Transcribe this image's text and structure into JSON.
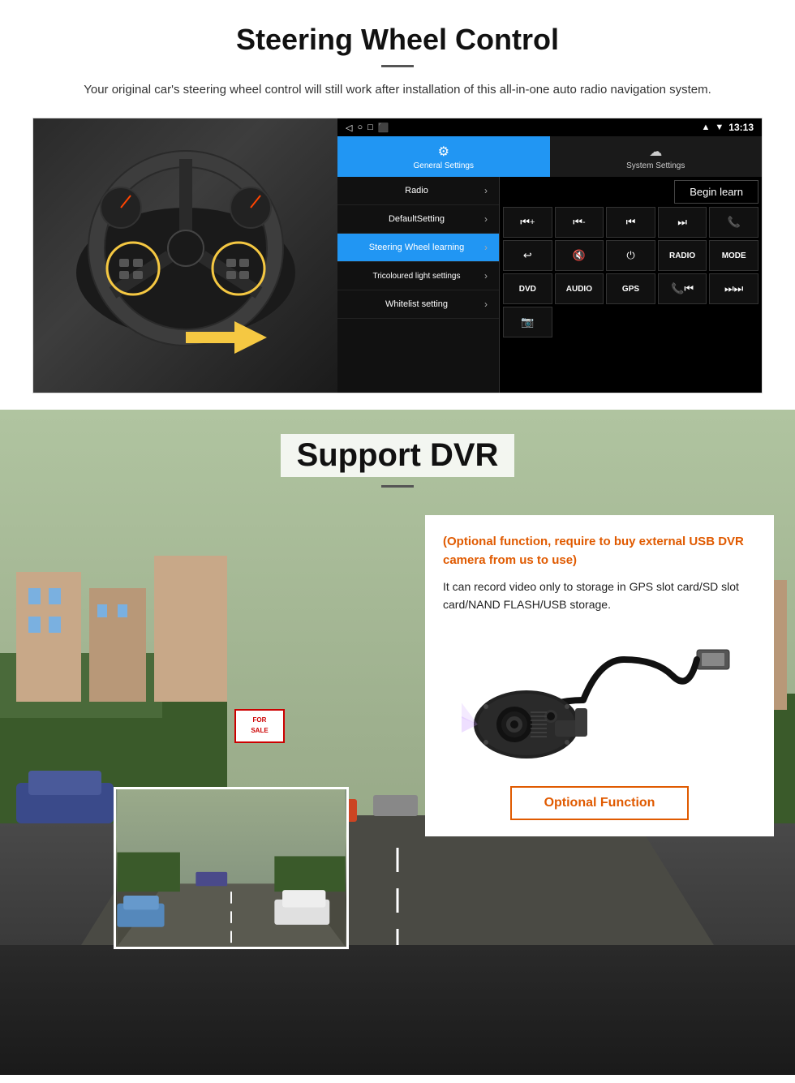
{
  "steering": {
    "title": "Steering Wheel Control",
    "subtitle": "Your original car's steering wheel control will still work after installation of this all-in-one auto radio navigation system.",
    "statusbar": {
      "time": "13:13",
      "icons": [
        "▲",
        "▼",
        "□",
        "⬛"
      ]
    },
    "tabs": {
      "general": "General Settings",
      "system": "System Settings"
    },
    "menu_items": [
      {
        "label": "Radio",
        "active": false
      },
      {
        "label": "DefaultSetting",
        "active": false
      },
      {
        "label": "Steering Wheel learning",
        "active": true
      },
      {
        "label": "Tricoloured light settings",
        "active": false
      },
      {
        "label": "Whitelist setting",
        "active": false
      }
    ],
    "begin_learn": "Begin learn",
    "control_buttons": [
      "⏮+",
      "⏮-",
      "⏮",
      "⏭",
      "📞",
      "↩",
      "🔇",
      "⏻",
      "RADIO",
      "MODE",
      "DVD",
      "AUDIO",
      "GPS",
      "📞⏮",
      "⏭⏭"
    ],
    "dvr_icon": "📷"
  },
  "dvr": {
    "title": "Support DVR",
    "optional_notice": "(Optional function, require to buy external USB DVR camera from us to use)",
    "description": "It can record video only to storage in GPS slot card/SD slot card/NAND FLASH/USB storage.",
    "optional_function_btn": "Optional Function"
  }
}
